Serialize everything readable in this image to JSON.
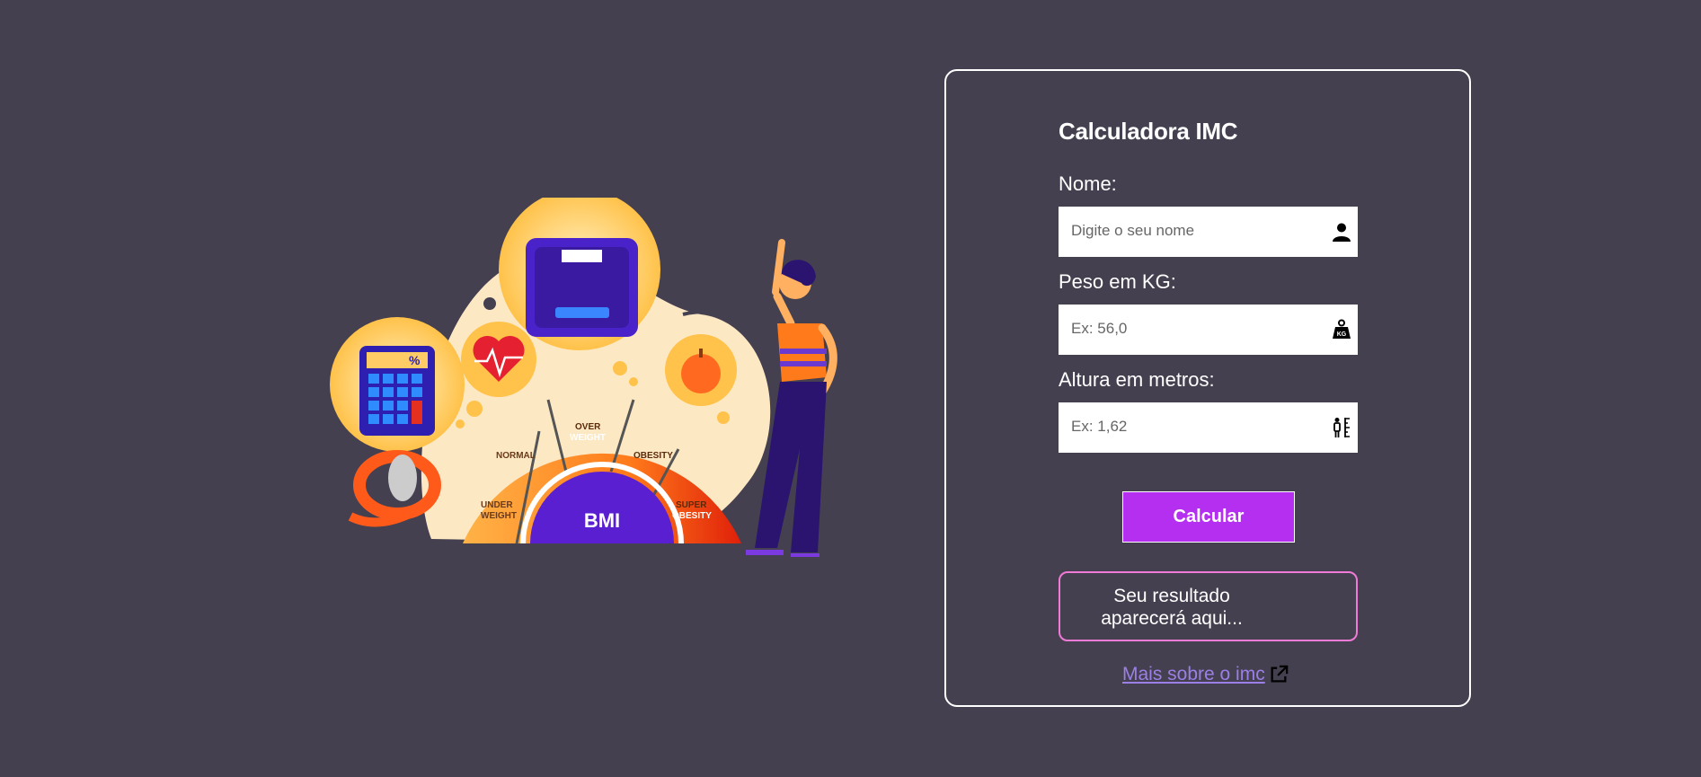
{
  "illustration": {
    "bmi_label": "BMI",
    "segments": [
      "UNDER WEIGHT",
      "NORMAL",
      "OVER WEIGHT",
      "OBESITY",
      "SUPER OBESITY"
    ],
    "calculator_symbol": "%",
    "weight_badge": "KG"
  },
  "form": {
    "title": "Calculadora IMC",
    "name_label": "Nome:",
    "name_placeholder": "Digite o seu nome",
    "weight_label": "Peso em KG:",
    "weight_placeholder": "Ex: 56,0",
    "height_label": "Altura em metros:",
    "height_placeholder": "Ex: 1,62",
    "calc_button": "Calcular",
    "result_line1": "Seu resultado",
    "result_line2": "aparecerá aqui...",
    "more_link": "Mais sobre o imc"
  },
  "colors": {
    "background": "#454050",
    "button": "#b52ff0",
    "result_border": "#f07ad8",
    "link": "#9b7fe6"
  }
}
